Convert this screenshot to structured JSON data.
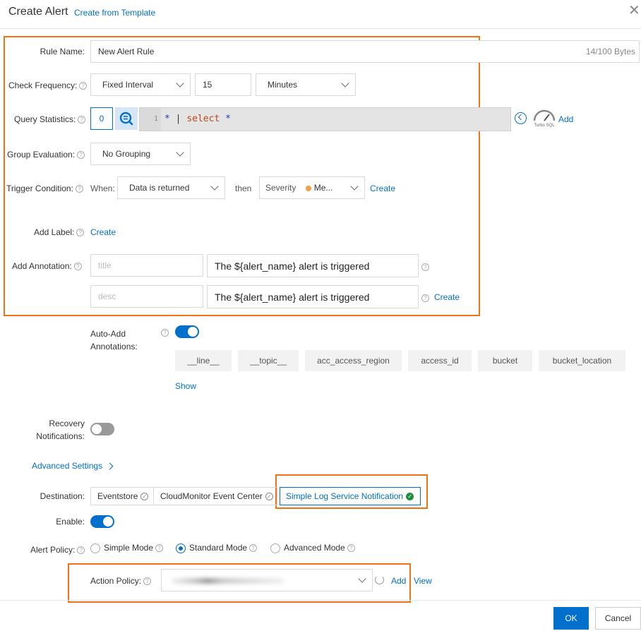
{
  "header": {
    "title": "Create Alert",
    "template_link": "Create from Template"
  },
  "rule_name": {
    "label": "Rule Name:",
    "value": "New Alert Rule",
    "counter": "14/100 Bytes"
  },
  "check_frequency": {
    "label": "Check Frequency:",
    "mode": "Fixed Interval",
    "value": "15",
    "unit": "Minutes"
  },
  "query_statistics": {
    "label": "Query Statistics:",
    "count": "0",
    "line_number": "1",
    "query_star": "*",
    "query_pipe": "|",
    "query_select": "select",
    "query_star2": "*",
    "turbo": "Turbo SQL",
    "add": "Add"
  },
  "group_evaluation": {
    "label": "Group Evaluation:",
    "value": "No Grouping"
  },
  "trigger_condition": {
    "label": "Trigger Condition:",
    "when": "When:",
    "when_value": "Data is returned",
    "then": "then",
    "severity_label": "Severity",
    "severity_value": "Me...",
    "create": "Create"
  },
  "add_label": {
    "label": "Add Label:",
    "create": "Create"
  },
  "add_annotation": {
    "label": "Add Annotation:",
    "rows": [
      {
        "key_placeholder": "title",
        "value": "The ${alert_name} alert is triggered"
      },
      {
        "key_placeholder": "desc",
        "value": "The ${alert_name} alert is triggered"
      }
    ],
    "create": "Create"
  },
  "auto_add": {
    "label_line1": "Auto-Add",
    "label_line2": "Annotations:",
    "tags": [
      "__line__",
      "__topic__",
      "acc_access_region",
      "access_id",
      "bucket",
      "bucket_location"
    ],
    "show": "Show"
  },
  "recovery": {
    "label_line1": "Recovery",
    "label_line2": "Notifications:"
  },
  "advanced_settings": "Advanced Settings",
  "destination": {
    "label": "Destination:",
    "options": [
      "Eventstore",
      "CloudMonitor Event Center",
      "Simple Log Service Notification"
    ]
  },
  "enable": {
    "label": "Enable:"
  },
  "alert_policy": {
    "label": "Alert Policy:",
    "options": [
      "Simple Mode",
      "Standard Mode",
      "Advanced Mode"
    ],
    "selected": "Standard Mode"
  },
  "action_policy": {
    "label": "Action Policy:",
    "add": "Add",
    "view": "View"
  },
  "footer": {
    "ok": "OK",
    "cancel": "Cancel"
  },
  "colors": {
    "accent": "#0070cc",
    "highlight": "#f07316",
    "success": "#1e8e3e"
  }
}
